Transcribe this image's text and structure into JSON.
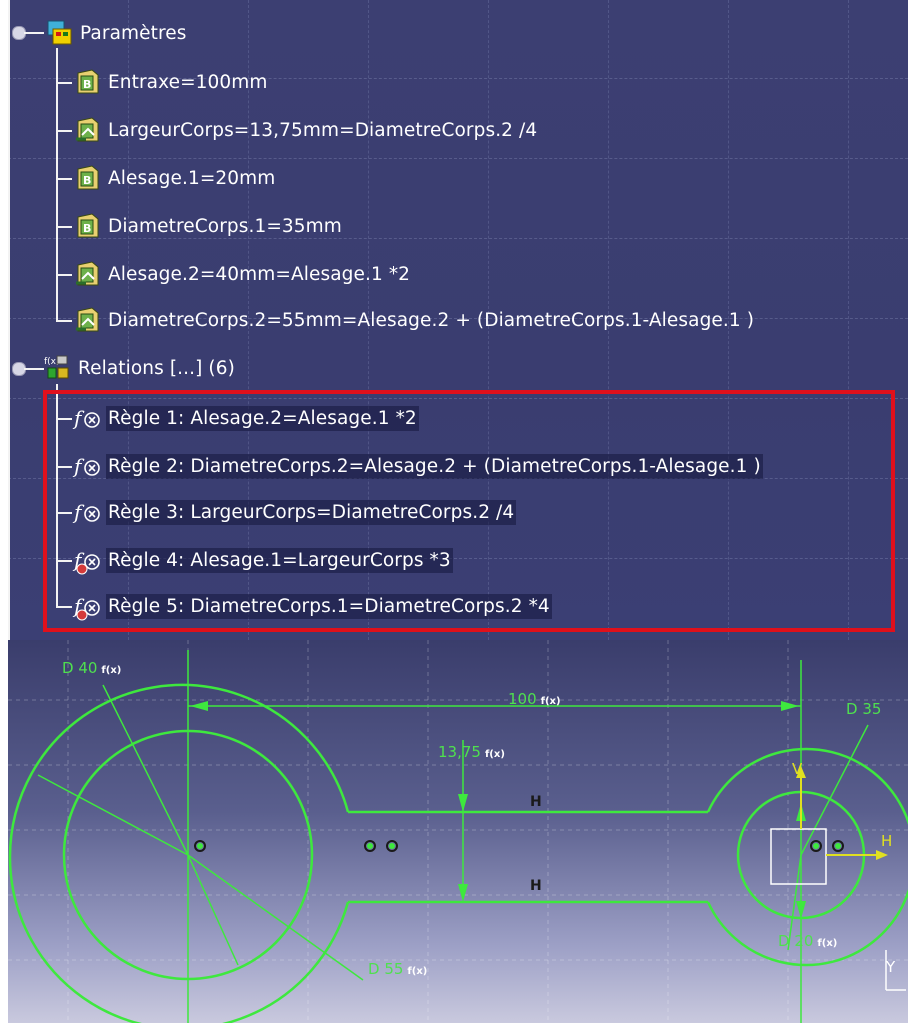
{
  "tree": {
    "parameters": {
      "label": "Paramètres",
      "items": [
        {
          "label": "Entraxe=100mm",
          "icon": "parameter-icon"
        },
        {
          "label": "LargeurCorps=13,75mm=DiametreCorps.2 /4",
          "icon": "formula-parameter-icon"
        },
        {
          "label": "Alesage.1=20mm",
          "icon": "parameter-icon"
        },
        {
          "label": "DiametreCorps.1=35mm",
          "icon": "parameter-icon"
        },
        {
          "label": "Alesage.2=40mm=Alesage.1 *2",
          "icon": "formula-parameter-icon"
        },
        {
          "label": "DiametreCorps.2=55mm=Alesage.2 + (DiametreCorps.1-Alesage.1 )",
          "icon": "formula-parameter-icon"
        }
      ]
    },
    "relations": {
      "label": "Relations [...] (6)",
      "items": [
        {
          "label": "Règle 1: Alesage.2=Alesage.1 *2",
          "icon": "formula-icon"
        },
        {
          "label": "Règle 2: DiametreCorps.2=Alesage.2 + (DiametreCorps.1-Alesage.1 )",
          "icon": "formula-icon"
        },
        {
          "label": "Règle 3: LargeurCorps=DiametreCorps.2 /4",
          "icon": "formula-icon"
        },
        {
          "label": "Règle 4: Alesage.1=LargeurCorps *3",
          "icon": "formula-inactive-icon"
        },
        {
          "label": "Règle 5: DiametreCorps.1=DiametreCorps.2 *4",
          "icon": "formula-inactive-icon"
        }
      ]
    }
  },
  "sketch": {
    "dimensions": {
      "d40": "D 40",
      "d35": "D 35",
      "d55": "D 55",
      "d20": "D 20",
      "entraxe": "100",
      "largeur": "13,75"
    },
    "axis": {
      "h": "H",
      "v": "V",
      "y": "Y"
    },
    "constraint_h": "H",
    "fx_tag": "f(x)",
    "colors": {
      "geometry": "#3ee83e",
      "background": "#3a3d6c"
    }
  }
}
